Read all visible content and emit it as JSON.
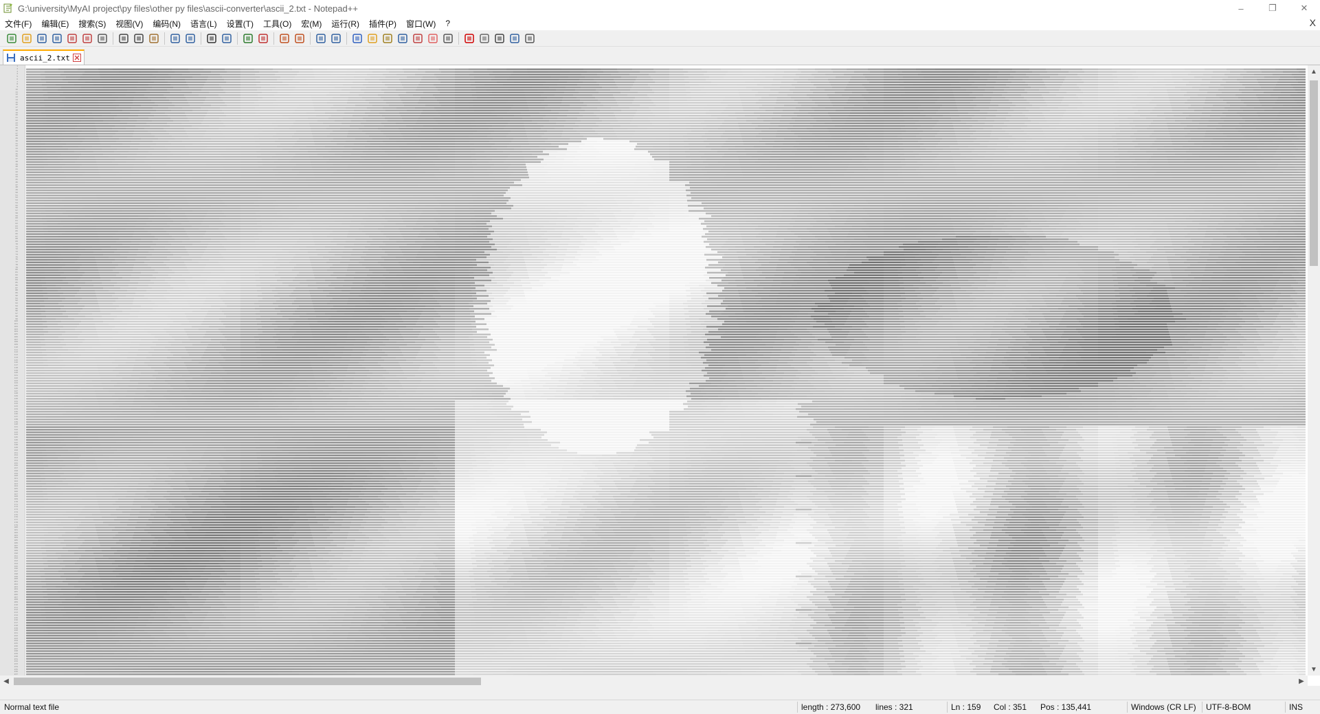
{
  "window": {
    "title": "G:\\university\\MyAI project\\py files\\other py files\\ascii-converter\\ascii_2.txt - Notepad++",
    "controls": [
      "–",
      "❐",
      "✕"
    ]
  },
  "menu": [
    "文件(F)",
    "编辑(E)",
    "搜索(S)",
    "视图(V)",
    "编码(N)",
    "语言(L)",
    "设置(T)",
    "工具(O)",
    "宏(M)",
    "运行(R)",
    "插件(P)",
    "窗口(W)",
    "?"
  ],
  "menu_close": "X",
  "toolbar": [
    [
      "new-file-icon",
      "#3a8a3a"
    ],
    [
      "open-file-icon",
      "#e0a020"
    ],
    [
      "save-icon",
      "#3060a0"
    ],
    [
      "save-all-icon",
      "#3060a0"
    ],
    [
      "close-icon",
      "#c04040"
    ],
    [
      "close-all-icon",
      "#c04040"
    ],
    [
      "print-icon",
      "#555555"
    ],
    null,
    [
      "cut-icon",
      "#444444"
    ],
    [
      "copy-icon",
      "#444444"
    ],
    [
      "paste-icon",
      "#a07030"
    ],
    null,
    [
      "undo-icon",
      "#3060a0"
    ],
    [
      "redo-icon",
      "#3060a0"
    ],
    null,
    [
      "find-icon",
      "#333333"
    ],
    [
      "replace-icon",
      "#3060a0"
    ],
    null,
    [
      "zoom-in-icon",
      "#2a7a2a"
    ],
    [
      "zoom-out-icon",
      "#c03030"
    ],
    null,
    [
      "sync-vertical-icon",
      "#c05020"
    ],
    [
      "sync-horizontal-icon",
      "#c05020"
    ],
    null,
    [
      "word-wrap-icon",
      "#3060a0"
    ],
    [
      "show-all-chars-icon",
      "#3060a0"
    ],
    null,
    [
      "indent-guide-icon",
      "#3060c0"
    ],
    [
      "udl-icon",
      "#e0a020"
    ],
    [
      "doc-map-icon",
      "#a08020"
    ],
    [
      "doc-list-icon",
      "#3060a0"
    ],
    [
      "function-list-icon",
      "#c04040"
    ],
    [
      "folder-workspace-icon",
      "#e06060"
    ],
    [
      "monitoring-icon",
      "#555555"
    ],
    null,
    [
      "record-macro-icon",
      "#d00000"
    ],
    [
      "stop-macro-icon",
      "#666666"
    ],
    [
      "play-macro-icon",
      "#444444"
    ],
    [
      "run-macro-multiple-icon",
      "#3060a0"
    ],
    [
      "save-macro-icon",
      "#555555"
    ]
  ],
  "tab": {
    "label": "ascii_2.txt"
  },
  "editor": {
    "line_count": 321
  },
  "status": {
    "type": "Normal text file",
    "length": "length : 273,600",
    "lines": "lines : 321",
    "ln": "Ln : 159",
    "col": "Col : 351",
    "pos": "Pos : 135,441",
    "eol": "Windows (CR LF)",
    "encoding": "UTF-8-BOM",
    "mode": "INS"
  }
}
